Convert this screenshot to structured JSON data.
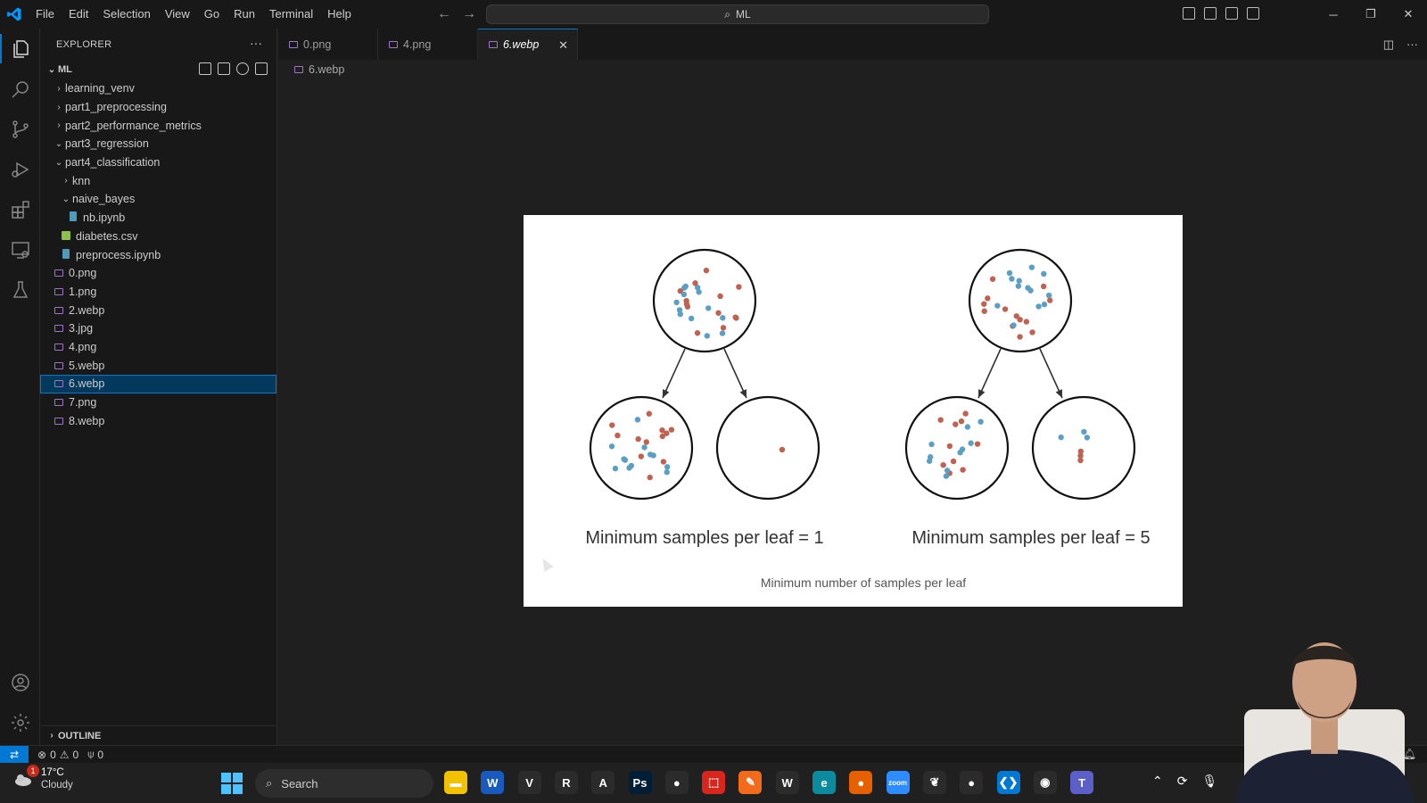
{
  "menu": [
    "File",
    "Edit",
    "Selection",
    "View",
    "Go",
    "Run",
    "Terminal",
    "Help"
  ],
  "command_center": {
    "label": "ML"
  },
  "explorer": {
    "title": "EXPLORER",
    "workspace": "ML",
    "tree": [
      {
        "label": "learning_venv",
        "indent": 1,
        "type": "folder",
        "open": false
      },
      {
        "label": "part1_preprocessing",
        "indent": 1,
        "type": "folder",
        "open": false
      },
      {
        "label": "part2_performance_metrics",
        "indent": 1,
        "type": "folder",
        "open": false
      },
      {
        "label": "part3_regression",
        "indent": 1,
        "type": "folder",
        "open": true
      },
      {
        "label": "part4_classification",
        "indent": 1,
        "type": "folder",
        "open": true
      },
      {
        "label": "knn",
        "indent": 2,
        "type": "folder",
        "open": false
      },
      {
        "label": "naive_bayes",
        "indent": 2,
        "type": "folder",
        "open": true
      },
      {
        "label": "nb.ipynb",
        "indent": 3,
        "type": "notebook"
      },
      {
        "label": "diabetes.csv",
        "indent": 2,
        "type": "csv"
      },
      {
        "label": "preprocess.ipynb",
        "indent": 2,
        "type": "notebook"
      },
      {
        "label": "0.png",
        "indent": 1,
        "type": "image"
      },
      {
        "label": "1.png",
        "indent": 1,
        "type": "image"
      },
      {
        "label": "2.webp",
        "indent": 1,
        "type": "image"
      },
      {
        "label": "3.jpg",
        "indent": 1,
        "type": "image"
      },
      {
        "label": "4.png",
        "indent": 1,
        "type": "image"
      },
      {
        "label": "5.webp",
        "indent": 1,
        "type": "image"
      },
      {
        "label": "6.webp",
        "indent": 1,
        "type": "image",
        "selected": true
      },
      {
        "label": "7.png",
        "indent": 1,
        "type": "image"
      },
      {
        "label": "8.webp",
        "indent": 1,
        "type": "image"
      }
    ],
    "outline": "OUTLINE"
  },
  "tabs": [
    {
      "label": "0.png",
      "active": false
    },
    {
      "label": "4.png",
      "active": false
    },
    {
      "label": "6.webp",
      "active": true
    }
  ],
  "breadcrumb": "6.webp",
  "figure": {
    "left_caption": "Minimum samples per leaf = 1",
    "right_caption": "Minimum samples per leaf = 5",
    "footer": "Minimum number of samples per leaf",
    "colors": {
      "red": "#c0624f",
      "blue": "#5b9fc4"
    }
  },
  "status": {
    "errors": "0",
    "warnings": "0",
    "ports": "0"
  },
  "taskbar": {
    "temperature": "17°C",
    "condition": "Cloudy",
    "weather_badge": "1",
    "search_placeholder": "Search",
    "apps": [
      {
        "name": "file-explorer",
        "glyph": "▬",
        "color": "#f2c200"
      },
      {
        "name": "word",
        "glyph": "W",
        "color": "#185abd"
      },
      {
        "name": "vim",
        "glyph": "V",
        "color": "#2b2b2b"
      },
      {
        "name": "r",
        "glyph": "R",
        "color": "#2b2b2b"
      },
      {
        "name": "acrobat",
        "glyph": "A",
        "color": "#2b2b2b"
      },
      {
        "name": "photoshop",
        "glyph": "Ps",
        "color": "#001e36"
      },
      {
        "name": "chrome",
        "glyph": "●",
        "color": "#2b2b2b"
      },
      {
        "name": "pdf-reader",
        "glyph": "⬚",
        "color": "#d9261c"
      },
      {
        "name": "draw",
        "glyph": "✎",
        "color": "#f26b1d"
      },
      {
        "name": "word-alt",
        "glyph": "W",
        "color": "#2b2b2b"
      },
      {
        "name": "edge",
        "glyph": "e",
        "color": "#0c8a9e"
      },
      {
        "name": "firefox",
        "glyph": "●",
        "color": "#e66000"
      },
      {
        "name": "zoom",
        "glyph": "zoom",
        "color": "#2d8cff"
      },
      {
        "name": "mongodb",
        "glyph": "❦",
        "color": "#2b2b2b"
      },
      {
        "name": "chrome-alt",
        "glyph": "●",
        "color": "#2b2b2b"
      },
      {
        "name": "vscode",
        "glyph": "❮❯",
        "color": "#0078d4"
      },
      {
        "name": "obs",
        "glyph": "◉",
        "color": "#2b2b2b"
      },
      {
        "name": "teams",
        "glyph": "T",
        "color": "#5b5fc7"
      }
    ]
  }
}
